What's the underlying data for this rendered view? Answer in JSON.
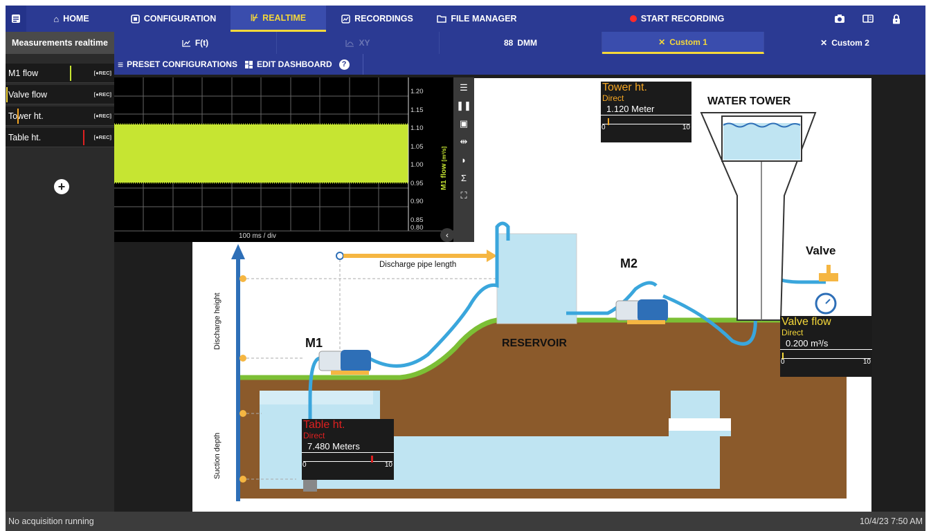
{
  "nav": {
    "items": [
      {
        "label": "HOME",
        "icon": "home-icon"
      },
      {
        "label": "CONFIGURATION",
        "icon": "config-icon"
      },
      {
        "label": "REALTIME",
        "icon": "realtime-icon"
      },
      {
        "label": "RECORDINGS",
        "icon": "recordings-icon"
      },
      {
        "label": "FILE MANAGER",
        "icon": "folder-icon"
      }
    ],
    "start_recording": "START RECORDING"
  },
  "sidebar": {
    "title": "Measurements realtime",
    "items": [
      {
        "label": "M1 flow",
        "rec": "[●REC]",
        "color": "#c6e532"
      },
      {
        "label": "Valve flow",
        "rec": "[●REC]",
        "color": "#f5d83a"
      },
      {
        "label": "Tower ht.",
        "rec": "[●REC]",
        "color": "#f5a623"
      },
      {
        "label": "Table ht.",
        "rec": "[●REC]",
        "color": "#e02020"
      }
    ]
  },
  "tabs": {
    "ft": "F(t)",
    "xy": "XY",
    "dmm": "DMM",
    "custom1": "Custom 1",
    "custom2": "Custom 2"
  },
  "toolbar": {
    "preset": "PRESET CONFIGURATIONS",
    "edit": "EDIT DASHBOARD",
    "help": "?"
  },
  "scope": {
    "ticks": [
      "1.20",
      "1.15",
      "1.10",
      "1.05",
      "1.00",
      "0.95",
      "0.90",
      "0.85",
      "0.80"
    ],
    "timebase": "100 ms / div",
    "ylabel": "M1 flow",
    "unit": "[m³/s]",
    "trace_color": "#c6e532"
  },
  "gauges": {
    "tower": {
      "name": "Tower ht.",
      "mode": "Direct",
      "value": "1.120 Meter",
      "min": "0",
      "max": "10",
      "fraction": 0.112,
      "color": "#f5a623"
    },
    "valve": {
      "name": "Valve flow",
      "mode": "Direct",
      "value": "0.200 m³/s",
      "min": "0",
      "max": "10",
      "fraction": 0.02,
      "color": "#f5d83a"
    },
    "table": {
      "name": "Table ht.",
      "mode": "Direct",
      "value": "7.480 Meters",
      "min": "0",
      "max": "10",
      "fraction": 0.748,
      "color": "#e02020"
    }
  },
  "diagram": {
    "water_tower": "WATER TOWER",
    "valve": "Valve",
    "reservoir": "RESERVOIR",
    "m1": "M1",
    "m2": "M2",
    "discharge_pipe": "Discharge pipe length",
    "discharge_height": "Discharge height",
    "suction_depth": "Suction depth"
  },
  "status": {
    "left": "No acquisition running",
    "right": "10/4/23 7:50 AM"
  }
}
